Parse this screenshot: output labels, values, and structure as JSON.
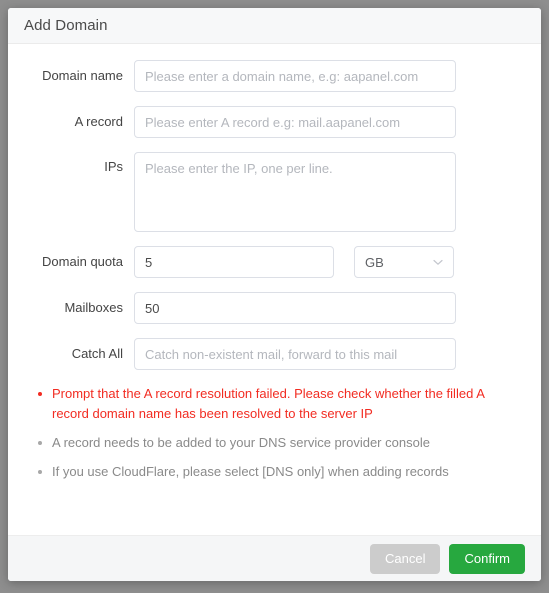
{
  "dialog": {
    "title": "Add Domain"
  },
  "form": {
    "domain_name": {
      "label": "Domain name",
      "placeholder": "Please enter a domain name, e.g: aapanel.com",
      "value": ""
    },
    "a_record": {
      "label": "A record",
      "placeholder": "Please enter A record e.g: mail.aapanel.com",
      "value": ""
    },
    "ips": {
      "label": "IPs",
      "placeholder": "Please enter the IP, one per line.",
      "value": ""
    },
    "domain_quota": {
      "label": "Domain quota",
      "value": "5",
      "unit": "GB"
    },
    "mailboxes": {
      "label": "Mailboxes",
      "value": "50"
    },
    "catch_all": {
      "label": "Catch All",
      "placeholder": "Catch non-existent mail, forward to this mail",
      "value": ""
    }
  },
  "notes": [
    "Prompt that the A record resolution failed. Please check whether the filled A record domain name has been resolved to the server IP",
    "A record needs to be added to your DNS service provider console",
    "If you use CloudFlare, please select [DNS only] when adding records"
  ],
  "footer": {
    "cancel_label": "Cancel",
    "confirm_label": "Confirm"
  },
  "colors": {
    "error": "#f22c22",
    "confirm": "#27a83f",
    "cancel": "#cccccc",
    "note": "#8a8a8a"
  }
}
